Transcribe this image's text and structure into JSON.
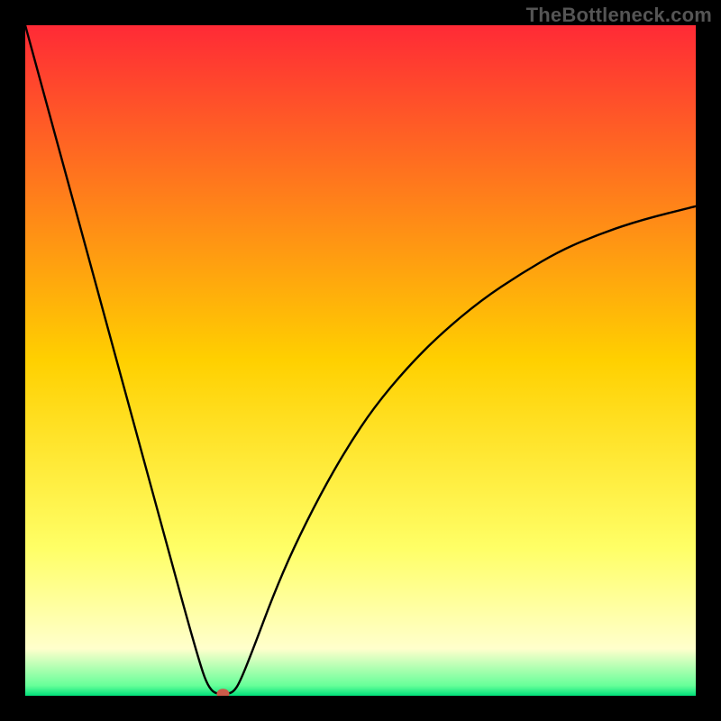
{
  "watermark": "TheBottleneck.com",
  "chart_data": {
    "type": "line",
    "title": "",
    "xlabel": "",
    "ylabel": "",
    "xlim": [
      0,
      100
    ],
    "ylim": [
      0,
      100
    ],
    "background_gradient": {
      "stops": [
        {
          "offset": 0.0,
          "color": "#ff2a36"
        },
        {
          "offset": 0.5,
          "color": "#ffd000"
        },
        {
          "offset": 0.78,
          "color": "#ffff66"
        },
        {
          "offset": 0.93,
          "color": "#ffffcc"
        },
        {
          "offset": 0.985,
          "color": "#66ff99"
        },
        {
          "offset": 1.0,
          "color": "#00e07a"
        }
      ]
    },
    "series": [
      {
        "name": "bottleneck-curve",
        "color": "#000000",
        "x": [
          0,
          3,
          6,
          9,
          12,
          15,
          18,
          21,
          24,
          26,
          27,
          28,
          29,
          30,
          31,
          32,
          34,
          37,
          40,
          44,
          48,
          52,
          57,
          62,
          68,
          74,
          80,
          86,
          92,
          100
        ],
        "y": [
          100,
          89,
          78,
          67,
          56,
          45,
          34,
          23,
          12,
          5,
          2,
          0.5,
          0.3,
          0.3,
          0.5,
          2,
          7,
          15,
          22,
          30,
          37,
          43,
          49,
          54,
          59,
          63,
          66.5,
          69,
          71,
          73
        ]
      }
    ],
    "marker": {
      "x": 29.5,
      "y": 0.3,
      "color": "#cc5b4a",
      "r": 6
    },
    "legend": null,
    "grid": false
  }
}
